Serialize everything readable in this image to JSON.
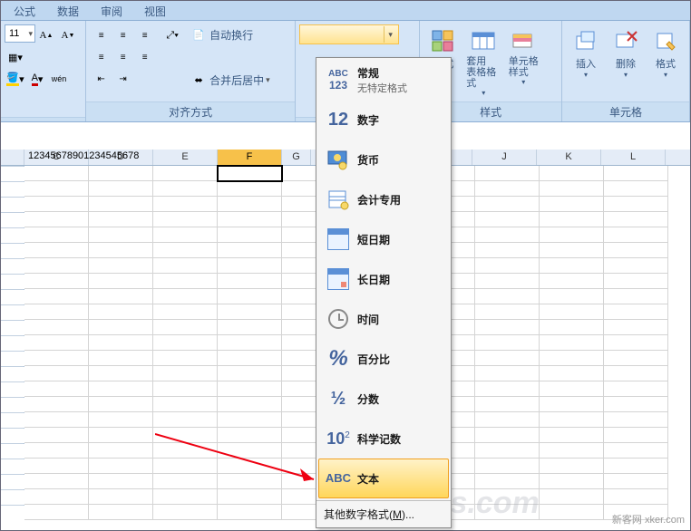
{
  "tabs": [
    "公式",
    "数据",
    "审阅",
    "视图"
  ],
  "ribbon": {
    "font_size": "11",
    "wrap_text": "自动换行",
    "merge_center": "合并后居中",
    "align_label": "对齐方式",
    "styles_label": "样式",
    "cells_label": "单元格",
    "cond_fmt": "格式",
    "tbl_fmt": "套用\n表格格式",
    "cell_styles": "单元格\n样式",
    "insert": "插入",
    "delete": "删除",
    "format": "格式"
  },
  "format_menu": {
    "items": [
      {
        "label": "常规",
        "sub": "无特定格式",
        "icon": "abc123"
      },
      {
        "label": "数字",
        "sub": "",
        "icon": "12"
      },
      {
        "label": "货币",
        "sub": "",
        "icon": "money"
      },
      {
        "label": "会计专用",
        "sub": "",
        "icon": "ledger"
      },
      {
        "label": "短日期",
        "sub": "",
        "icon": "cal"
      },
      {
        "label": "长日期",
        "sub": "",
        "icon": "cal2"
      },
      {
        "label": "时间",
        "sub": "",
        "icon": "clock"
      },
      {
        "label": "百分比",
        "sub": "",
        "icon": "pct"
      },
      {
        "label": "分数",
        "sub": "",
        "icon": "frac"
      },
      {
        "label": "科学记数",
        "sub": "",
        "icon": "sci"
      },
      {
        "label": "文本",
        "sub": "",
        "icon": "abc",
        "selected": true
      }
    ],
    "more": "其他数字格式",
    "more_key": "M"
  },
  "sheet": {
    "cols": [
      "C",
      "D",
      "E",
      "F",
      "G",
      "J",
      "K",
      "L"
    ],
    "active_col": "F",
    "cell_value": "12345678901234545678"
  },
  "watermark": "新客网 xker.com",
  "watermark2": "MyDrivers.com"
}
